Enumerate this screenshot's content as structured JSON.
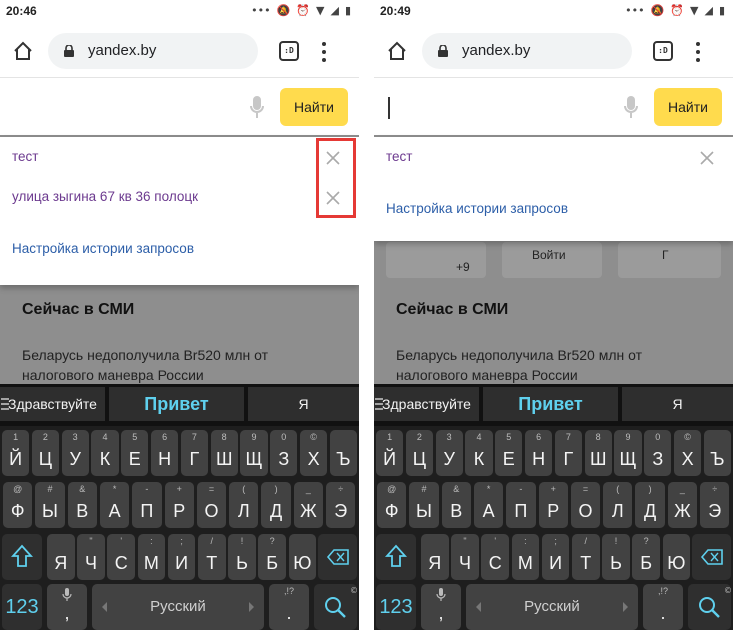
{
  "panels": [
    {
      "status": {
        "time": "20:46"
      },
      "browser": {
        "url": "yandex.by",
        "tabs_label": ":D"
      },
      "search": {
        "button_label": "Найти",
        "query": ""
      },
      "suggestions": [
        {
          "text": "тест"
        },
        {
          "text": "улица зыгина 67 кв 36 полоцк"
        }
      ],
      "history_settings": "Настройка истории запросов",
      "news": {
        "title": "Сейчас в СМИ",
        "text": "Беларусь недополучила Br520 млн от налогового маневра России"
      }
    },
    {
      "status": {
        "time": "20:49"
      },
      "browser": {
        "url": "yandex.by",
        "tabs_label": ":D"
      },
      "search": {
        "button_label": "Найти",
        "query": ""
      },
      "suggestions": [
        {
          "text": "тест"
        }
      ],
      "history_settings": "Настройка истории запросов",
      "tiles": {
        "count": "+9",
        "login": "Войти",
        "partial": "Г"
      },
      "news": {
        "title": "Сейчас в СМИ",
        "text": "Беларусь недополучила Br520 млн от налогового маневра России"
      }
    }
  ],
  "keyboard": {
    "candidates": [
      "Здравствуйте",
      "Привет",
      "Я"
    ],
    "row1": [
      {
        "key": "Й",
        "hint": "1"
      },
      {
        "key": "Ц",
        "hint": "2"
      },
      {
        "key": "У",
        "hint": "3"
      },
      {
        "key": "К",
        "hint": "4"
      },
      {
        "key": "Е",
        "hint": "5"
      },
      {
        "key": "Н",
        "hint": "6"
      },
      {
        "key": "Г",
        "hint": "7"
      },
      {
        "key": "Ш",
        "hint": "8"
      },
      {
        "key": "Щ",
        "hint": "9"
      },
      {
        "key": "З",
        "hint": "0"
      },
      {
        "key": "Х",
        "hint": "©"
      },
      {
        "key": "Ъ",
        "hint": ""
      }
    ],
    "row2": [
      {
        "key": "Ф",
        "hint": "@"
      },
      {
        "key": "Ы",
        "hint": "#"
      },
      {
        "key": "В",
        "hint": "&"
      },
      {
        "key": "А",
        "hint": "*"
      },
      {
        "key": "П",
        "hint": "-"
      },
      {
        "key": "Р",
        "hint": "+"
      },
      {
        "key": "О",
        "hint": "="
      },
      {
        "key": "Л",
        "hint": "("
      },
      {
        "key": "Д",
        "hint": ")"
      },
      {
        "key": "Ж",
        "hint": "_"
      },
      {
        "key": "Э",
        "hint": "÷"
      }
    ],
    "row3": [
      {
        "key": "Я",
        "hint": ""
      },
      {
        "key": "Ч",
        "hint": "\""
      },
      {
        "key": "С",
        "hint": "'"
      },
      {
        "key": "М",
        "hint": ":"
      },
      {
        "key": "И",
        "hint": ";"
      },
      {
        "key": "Т",
        "hint": "/"
      },
      {
        "key": "Ь",
        "hint": "!"
      },
      {
        "key": "Б",
        "hint": "?"
      },
      {
        "key": "Ю",
        "hint": ""
      }
    ],
    "label_123": "123",
    "comma": ",",
    "space_label": "Русский",
    "period": ".",
    "period_hint": ",!?",
    "icons": {
      "shift": "shift-icon",
      "backspace": "backspace-icon",
      "search": "search-icon",
      "mic": "mic-icon"
    }
  },
  "colors": {
    "search_button": "#ffdb4d",
    "suggestion": "#6c3a8f",
    "link": "#2c5ea8",
    "highlight": "#e53935",
    "keyboard_accent": "#5fd0ee"
  }
}
